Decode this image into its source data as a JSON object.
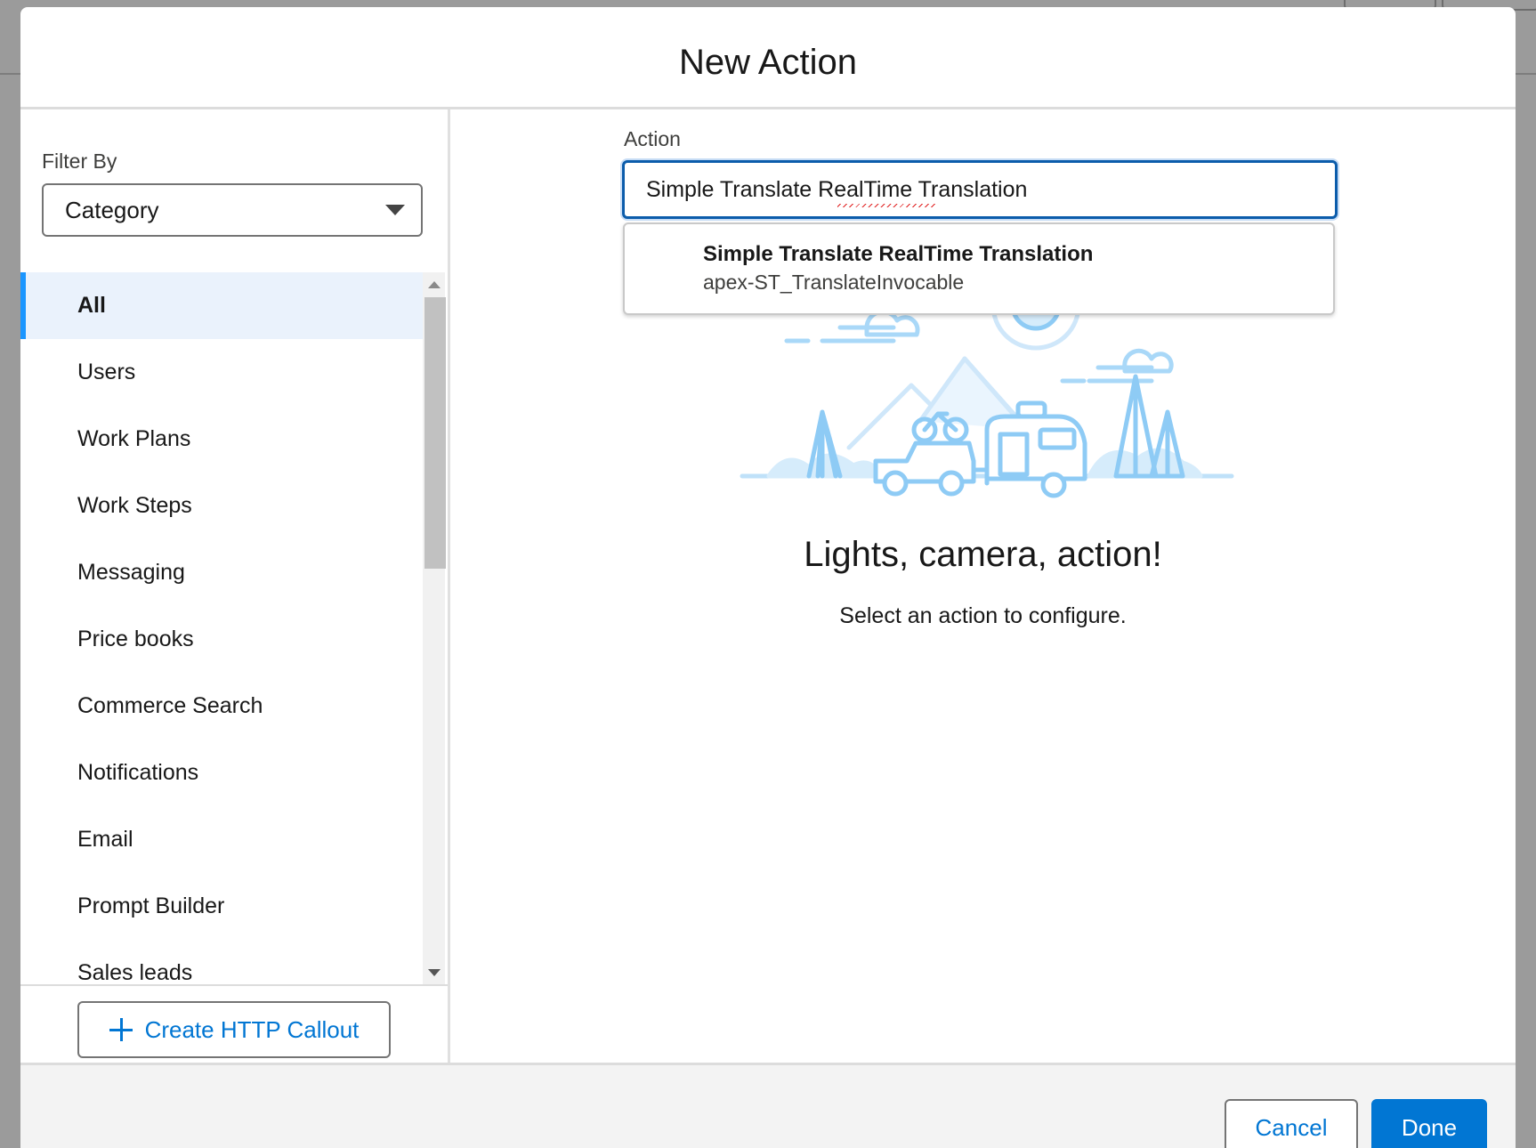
{
  "modal": {
    "title": "New Action"
  },
  "filter": {
    "label": "Filter By",
    "selected": "Category"
  },
  "categories": [
    {
      "label": "All",
      "selected": true
    },
    {
      "label": "Users"
    },
    {
      "label": "Work Plans"
    },
    {
      "label": "Work Steps"
    },
    {
      "label": "Messaging"
    },
    {
      "label": "Price books"
    },
    {
      "label": "Commerce Search"
    },
    {
      "label": "Notifications"
    },
    {
      "label": "Email"
    },
    {
      "label": "Prompt Builder"
    },
    {
      "label": "Sales leads"
    }
  ],
  "create_callout_label": "Create HTTP Callout",
  "action": {
    "label": "Action",
    "value": "Simple Translate RealTime Translation",
    "suggestion": {
      "title": "Simple Translate RealTime Translation",
      "subtitle": "apex-ST_TranslateInvocable"
    }
  },
  "empty_state": {
    "title": "Lights, camera, action!",
    "subtitle": "Select an action to configure."
  },
  "footer": {
    "cancel_label": "Cancel",
    "done_label": "Done"
  },
  "colors": {
    "brand": "#0176d3",
    "selected_bg": "#eaf2fc",
    "focus_border": "#0b5cab"
  },
  "icons": [
    "plus-icon",
    "chevron-down-icon",
    "camping-illustration"
  ]
}
